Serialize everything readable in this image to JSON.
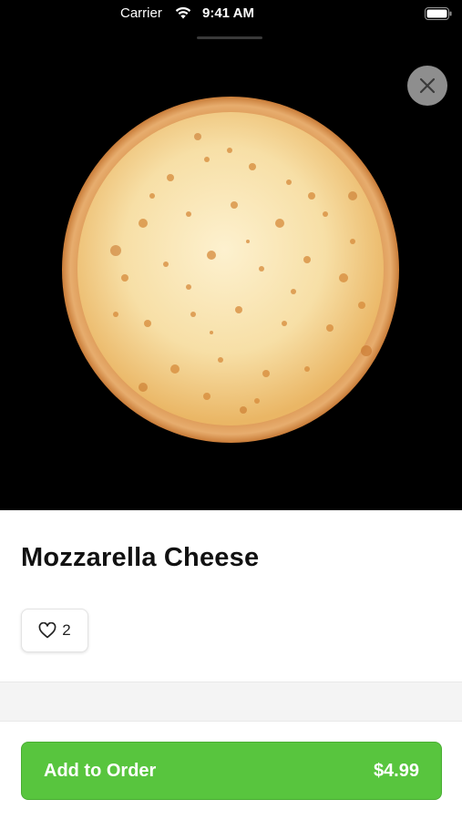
{
  "status_bar": {
    "carrier": "Carrier",
    "time": "9:41 AM",
    "wifi_icon": "wifi-icon",
    "battery_icon": "battery-icon"
  },
  "hero": {
    "image": "pizza-photo",
    "close_icon": "close-icon"
  },
  "product": {
    "title": "Mozzarella Cheese",
    "likes": "2",
    "heart_icon": "heart-outline-icon"
  },
  "order_button": {
    "label": "Add to Order",
    "price": "$4.99"
  },
  "colors": {
    "accent": "#58c53e",
    "hero_background": "#000000",
    "close_button": "#8e8e8e"
  }
}
